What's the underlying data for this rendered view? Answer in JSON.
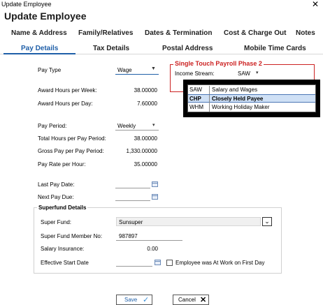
{
  "window": {
    "title": "Update Employee",
    "close_glyph": "✕"
  },
  "heading": "Update Employee",
  "tabs_row1": [
    "Name & Address",
    "Family/Relatives",
    "Dates & Termination",
    "Cost & Charge Out",
    "Notes"
  ],
  "tabs_row2": [
    "Pay Details",
    "Tax Details",
    "Postal Address",
    "Mobile Time Cards"
  ],
  "active_tab": "Pay Details",
  "pay": {
    "pay_type_label": "Pay Type",
    "pay_type_value": "Wage",
    "award_hours_week_label": "Award Hours per Week:",
    "award_hours_week_value": "38.00000",
    "award_hours_day_label": "Award Hours per Day:",
    "award_hours_day_value": "7.60000",
    "pay_period_label": "Pay Period:",
    "pay_period_value": "Weekly",
    "total_hours_label": "Total Hours per Pay Period:",
    "total_hours_value": "38.00000",
    "gross_pay_label": "Gross Pay per Pay Period:",
    "gross_pay_value": "1,330.00000",
    "pay_rate_label": "Pay Rate per Hour:",
    "pay_rate_value": "35.00000",
    "last_pay_label": "Last Pay Date:",
    "next_pay_label": "Next Pay Due:"
  },
  "stp": {
    "title": "Single Touch Payroll Phase 2",
    "income_stream_label": "Income Stream:",
    "income_stream_value": "SAW",
    "options": [
      {
        "code": "SAW",
        "desc": "Salary and Wages",
        "selected": false
      },
      {
        "code": "CHP",
        "desc": "Closely Held Payee",
        "selected": true
      },
      {
        "code": "WHM",
        "desc": "Working Holiday Maker",
        "selected": false
      }
    ]
  },
  "superfund": {
    "title": "Superfund Details",
    "fund_label": "Super Fund:",
    "fund_value": "Sunsuper",
    "member_label": "Super Fund Member No:",
    "member_value": "987897",
    "salary_ins_label": "Salary Insurance:",
    "salary_ins_value": "0.00",
    "effective_label": "Effective Start Date",
    "work_first_day_label": "Employee was At Work on First Day"
  },
  "buttons": {
    "save": "Save",
    "cancel": "Cancel"
  },
  "colors": {
    "accent": "#1f5fa8",
    "stp_red": "#cc2222",
    "selected_row": "#cfe0f5"
  },
  "icons": {
    "save": "check-icon",
    "cancel": "x-icon",
    "calendar": "calendar-icon",
    "dropdown": "chevron-down-icon"
  }
}
